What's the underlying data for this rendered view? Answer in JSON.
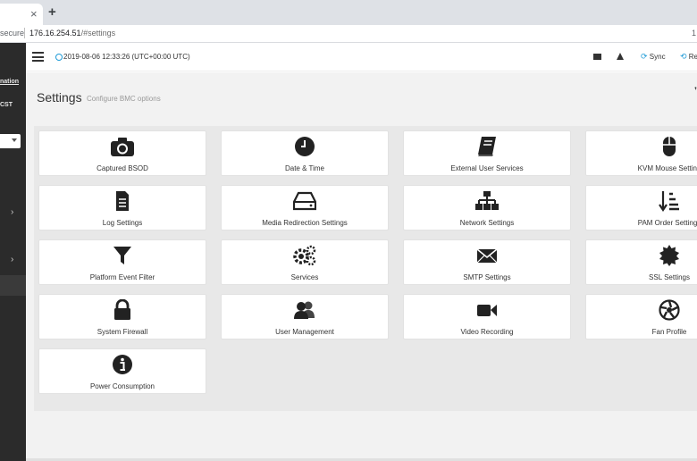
{
  "browser": {
    "tab_close": "×",
    "new_tab": "+",
    "secure_label": "secure",
    "url_host": "176.16.254.51",
    "url_path": "/#settings",
    "right_fragment": "1"
  },
  "sidebar": {
    "info_label": "nation",
    "tz_label": "CST",
    "chevrons": [
      "›",
      "›"
    ]
  },
  "topbar": {
    "datetime": "2019-08-06 12:33:26 (UTC+00:00 UTC)",
    "sync_label": "Sync",
    "refresh_label": "Re",
    "sync_icon": "⟳",
    "refresh_icon": "⟲"
  },
  "page": {
    "title": "Settings",
    "subtitle": "Configure BMC options",
    "right_icon": "❜"
  },
  "tiles": [
    {
      "label": "Captured BSOD",
      "icon": "camera-icon"
    },
    {
      "label": "Date & Time",
      "icon": "clock-icon"
    },
    {
      "label": "External User Services",
      "icon": "book-icon"
    },
    {
      "label": "KVM Mouse Setting",
      "icon": "mouse-icon"
    },
    {
      "label": "Log Settings",
      "icon": "document-icon"
    },
    {
      "label": "Media Redirection Settings",
      "icon": "drive-icon"
    },
    {
      "label": "Network Settings",
      "icon": "network-icon"
    },
    {
      "label": "PAM Order Settings",
      "icon": "sort-icon"
    },
    {
      "label": "Platform Event Filter",
      "icon": "filter-icon"
    },
    {
      "label": "Services",
      "icon": "gears-icon"
    },
    {
      "label": "SMTP Settings",
      "icon": "envelope-icon"
    },
    {
      "label": "SSL Settings",
      "icon": "certificate-icon"
    },
    {
      "label": "System Firewall",
      "icon": "lock-icon"
    },
    {
      "label": "User Management",
      "icon": "users-icon"
    },
    {
      "label": "Video Recording",
      "icon": "video-camera-icon"
    },
    {
      "label": "Fan Profile",
      "icon": "aperture-icon"
    },
    {
      "label": "Power Consumption",
      "icon": "info-icon"
    }
  ],
  "colors": {
    "accent": "#1f9bd7",
    "sidebar_bg": "#2b2b2b",
    "icon": "#222222"
  }
}
